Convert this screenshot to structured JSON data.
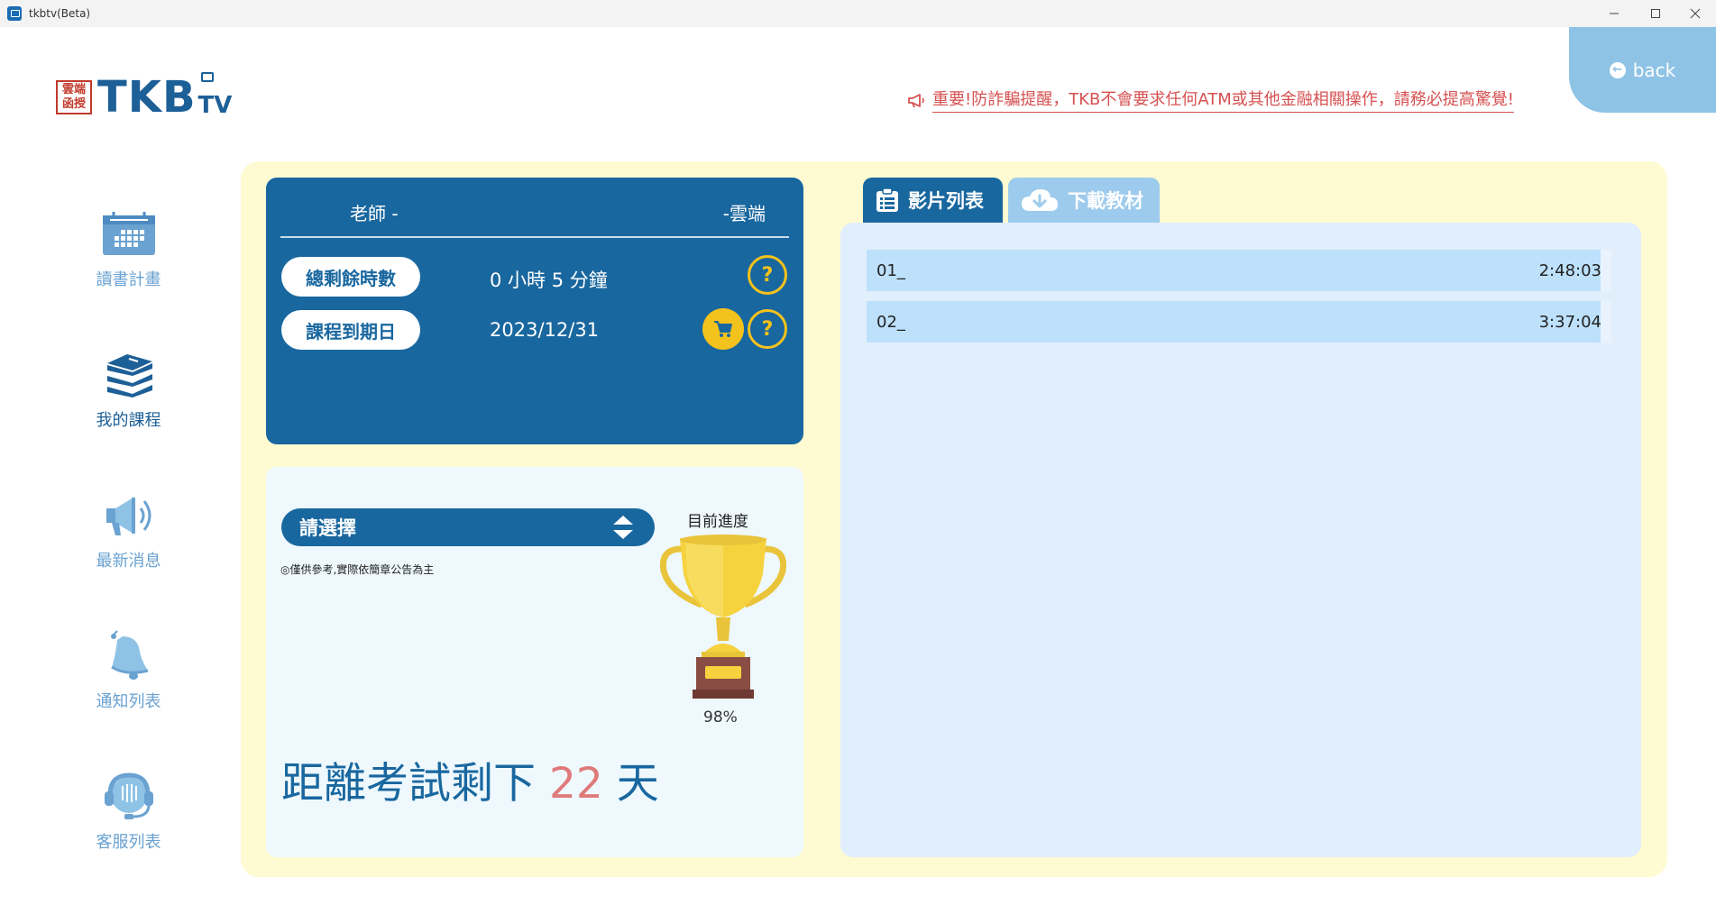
{
  "window": {
    "title": "tkbtv(Beta)",
    "controls": [
      "minimize",
      "maximize",
      "close"
    ]
  },
  "header": {
    "logo_seal": "雲端函授",
    "logo_brand": "TKB",
    "logo_tv": "TV",
    "notice": "重要!防詐騙提醒，TKB不會要求任何ATM或其他金融相關操作，請務必提高驚覺!",
    "back_label": "back"
  },
  "sidebar": {
    "items": [
      {
        "label": "讀書計畫",
        "icon": "calendar-icon",
        "active": false
      },
      {
        "label": "我的課程",
        "icon": "books-icon",
        "active": true
      },
      {
        "label": "最新消息",
        "icon": "megaphone-icon",
        "active": false
      },
      {
        "label": "通知列表",
        "icon": "bell-icon",
        "active": false
      },
      {
        "label": "客服列表",
        "icon": "headset-icon",
        "active": false
      }
    ]
  },
  "course": {
    "teacher": "老師 -",
    "platform": "-雲端",
    "remaining_label": "總剩餘時數",
    "remaining_value": "0 小時 5 分鐘",
    "expiry_label": "課程到期日",
    "expiry_value": "2023/12/31",
    "help_symbol": "?"
  },
  "progress": {
    "select_placeholder": "請選擇",
    "note": "◎僅供參考,實際依簡章公告為主",
    "label": "目前進度",
    "value": "98%",
    "countdown_prefix": "距離考試剩下",
    "countdown_days": "22",
    "countdown_suffix": "天"
  },
  "tabs": {
    "videos": "影片列表",
    "download": "下載教材"
  },
  "videos": [
    {
      "name": "01_",
      "duration": "2:48:03"
    },
    {
      "name": "02_",
      "duration": "3:37:04"
    }
  ],
  "colors": {
    "primary": "#19679f",
    "panel_yellow": "#fefbd2",
    "accent_yellow": "#f4c21c",
    "back_button": "#8ec3e6",
    "notice_red": "#d65151",
    "countdown_days": "#e07a7a"
  }
}
